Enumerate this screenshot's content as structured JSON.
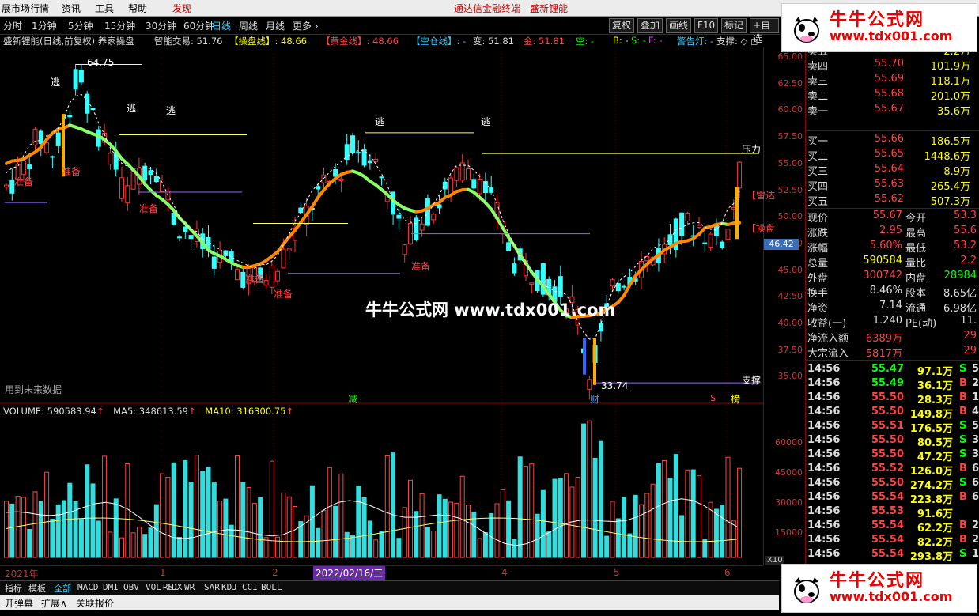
{
  "menubar": {
    "items": [
      "展市场行情",
      "资讯",
      "工具",
      "帮助",
      "发现"
    ],
    "center_links": [
      "通达信金融终端",
      "盛新锂能"
    ]
  },
  "toolbar": {
    "periods": [
      "分时",
      "1分钟",
      "5分钟",
      "15分钟",
      "30分钟",
      "60分钟",
      "日线",
      "周线",
      "月线",
      "更多 ›"
    ],
    "selected": "日线",
    "right_buttons": [
      "复权",
      "叠加",
      "画线",
      "F10",
      "标记",
      "+自选"
    ]
  },
  "indicator_line": {
    "title": "盛新锂能(日线,前复权) 养家操盘",
    "smart": "智能交易: 51.76",
    "caopan": "【操盘线】: 48.66",
    "huangjin": "【黄金线】: 48.66",
    "kongcang": "【空仓线】: -",
    "bian": "变: 51.81",
    "jin": "金: 51.81",
    "kong": "空: -",
    "b": "B: -",
    "s": "S: -",
    "f": "F: -",
    "alert": "警告灯: -",
    "support": "支撑: ◇ ◻"
  },
  "chart_data": {
    "type": "candlestick",
    "price_axis": [
      "65.00",
      "62.50",
      "60.00",
      "57.50",
      "55.00",
      "52.50",
      "50.00",
      "47.50",
      "45.00",
      "42.50",
      "40.00",
      "37.50",
      "35.00"
    ],
    "ylim": [
      33,
      66
    ],
    "current_price_label": "46.42",
    "high_label": "64.75",
    "low_label": "33.74",
    "annotations": [
      "逃",
      "逃",
      "逃",
      "逃",
      "逃",
      "准备",
      "准备",
      "准备",
      "准备",
      "准备",
      "准备",
      "压力",
      "支撑",
      "【雷达",
      "【操盘"
    ],
    "future_note": "用到未来数据",
    "event_marks": [
      "减",
      "财",
      "$",
      "榜"
    ],
    "time_labels": [
      "2021年",
      "1",
      "2",
      "2022/02/16/三",
      "4",
      "5",
      "6"
    ],
    "volume": {
      "header": "VOLUME: 590583.94",
      "ma5": "MA5: 348613.59",
      "ma10": "MA10: 316300.75",
      "axis": [
        "60000",
        "45000",
        "30000",
        "15000"
      ],
      "unit": "X10"
    }
  },
  "center_watermark": "牛牛公式网 www.tdx001.com",
  "watermark": {
    "title": "牛牛公式网",
    "url": "www.tdx001.com"
  },
  "order_book": {
    "sell": [
      {
        "label": "卖五",
        "price": "55.71",
        "vol": "2.2万"
      },
      {
        "label": "卖四",
        "price": "55.70",
        "vol": "101.9万"
      },
      {
        "label": "卖三",
        "price": "55.69",
        "vol": "118.1万"
      },
      {
        "label": "卖二",
        "price": "55.68",
        "vol": "201.0万"
      },
      {
        "label": "卖一",
        "price": "55.67",
        "vol": "35.6万"
      }
    ],
    "buy": [
      {
        "label": "买一",
        "price": "55.66",
        "vol": "186.5万"
      },
      {
        "label": "买二",
        "price": "55.65",
        "vol": "1448.6万"
      },
      {
        "label": "买三",
        "price": "55.64",
        "vol": "8.9万"
      },
      {
        "label": "买四",
        "price": "55.63",
        "vol": "265.4万"
      },
      {
        "label": "买五",
        "price": "55.62",
        "vol": "507.3万"
      }
    ]
  },
  "quote": [
    {
      "l1": "现价",
      "v1": "55.67",
      "l2": "今开",
      "v2": "53.3"
    },
    {
      "l1": "涨跌",
      "v1": "2.95",
      "l2": "最高",
      "v2": "55.6"
    },
    {
      "l1": "涨幅",
      "v1": "5.60%",
      "l2": "最低",
      "v2": "53.2"
    },
    {
      "l1": "总量",
      "v1": "590584",
      "l2": "量比",
      "v2": "2.2"
    },
    {
      "l1": "外盘",
      "v1": "300742",
      "l2": "内盘",
      "v2": "28984"
    },
    {
      "l1": "换手",
      "v1": "8.46%",
      "l2": "股本",
      "v2": "8.65亿"
    },
    {
      "l1": "净资",
      "v1": "7.14",
      "l2": "流通",
      "v2": "6.98亿"
    },
    {
      "l1": "收益(一)",
      "v1": "1.240",
      "l2": "PE(动)",
      "v2": "11."
    },
    {
      "l1": "净流入额",
      "v1": "6389万",
      "l2": "",
      "v2": "29"
    },
    {
      "l1": "大宗流入",
      "v1": "5817万",
      "l2": "",
      "v2": "29"
    }
  ],
  "ticks": [
    {
      "t": "14:56",
      "p": "55.47",
      "v": "97.1万",
      "bs": "S",
      "n": "5"
    },
    {
      "t": "14:56",
      "p": "55.49",
      "v": "36.1万",
      "bs": "B",
      "n": "2"
    },
    {
      "t": "14:56",
      "p": "55.50",
      "v": "28.3万",
      "bs": "B",
      "n": "1"
    },
    {
      "t": "14:56",
      "p": "55.50",
      "v": "149.8万",
      "bs": "B",
      "n": "4"
    },
    {
      "t": "14:56",
      "p": "55.51",
      "v": "176.5万",
      "bs": "S",
      "n": "5"
    },
    {
      "t": "14:56",
      "p": "55.50",
      "v": "80.5万",
      "bs": "S",
      "n": "3"
    },
    {
      "t": "14:56",
      "p": "55.50",
      "v": "47.2万",
      "bs": "S",
      "n": "3"
    },
    {
      "t": "14:56",
      "p": "55.52",
      "v": "126.0万",
      "bs": "B",
      "n": "6"
    },
    {
      "t": "14:56",
      "p": "55.50",
      "v": "274.2万",
      "bs": "S",
      "n": "6"
    },
    {
      "t": "14:56",
      "p": "55.54",
      "v": "223.8万",
      "bs": "B",
      "n": "6"
    },
    {
      "t": "14:56",
      "p": "55.53",
      "v": "91.6万",
      "bs": "",
      "n": ""
    },
    {
      "t": "14:56",
      "p": "55.54",
      "v": "62.2万",
      "bs": "B",
      "n": "2"
    },
    {
      "t": "14:56",
      "p": "55.54",
      "v": "82.2万",
      "bs": "B",
      "n": "2"
    },
    {
      "t": "14:56",
      "p": "55.54",
      "v": "293.8万",
      "bs": "S",
      "n": "14"
    }
  ],
  "bottom_tabs": [
    "指标",
    "模板",
    "全部",
    "MACD",
    "DMI",
    "OBV",
    "VOL-TDX",
    "RSI",
    "WR",
    "SAR",
    "KDJ",
    "CCI",
    "BOLL"
  ],
  "status_items": [
    "开弹幕",
    "扩展∧",
    "关联报价"
  ],
  "colors": {
    "up": "#ff3333",
    "down": "#33ffff",
    "caopan": "#ff8800",
    "huangjin": "#88ff66",
    "ma5": "#ffffff",
    "ma10": "#ffff66"
  }
}
